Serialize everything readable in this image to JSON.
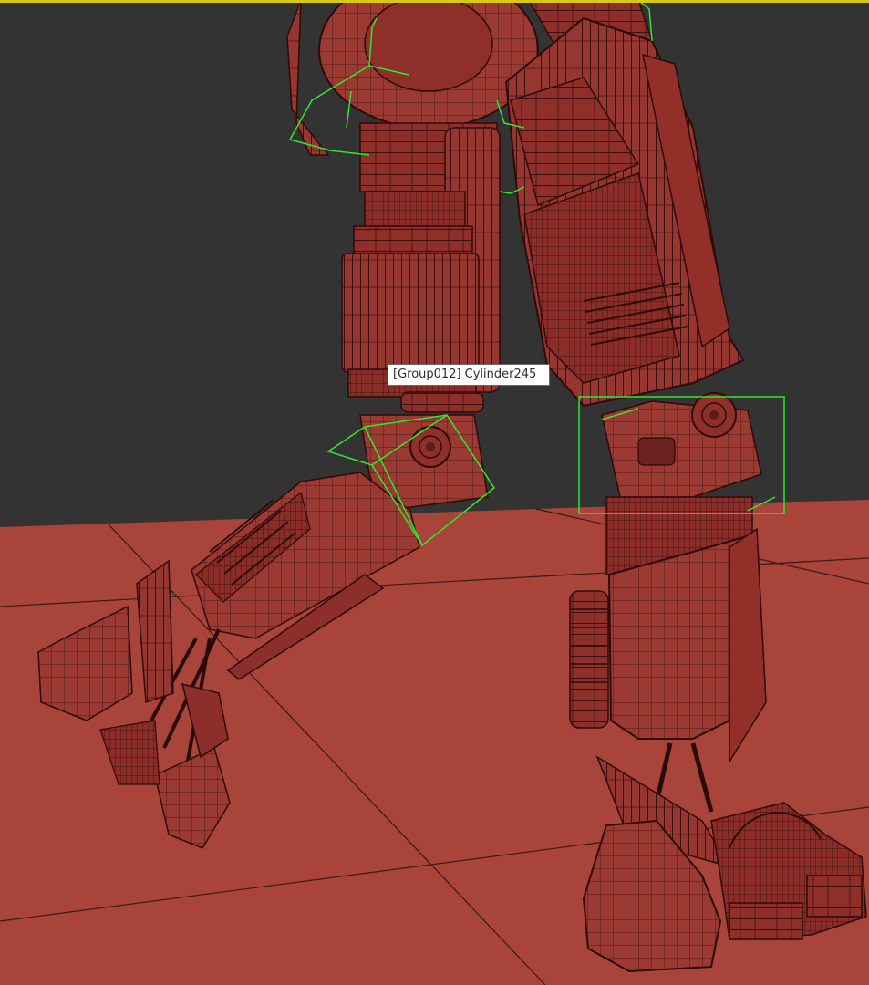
{
  "viewport": {
    "background_color": "#333333",
    "floor_color": "#a8443a",
    "model_color": "#8c2f2a",
    "selection_box_color": "#2fe82f",
    "active_border_color": "#d8c818"
  },
  "tooltip": {
    "text": "[Group012] Cylinder245"
  }
}
